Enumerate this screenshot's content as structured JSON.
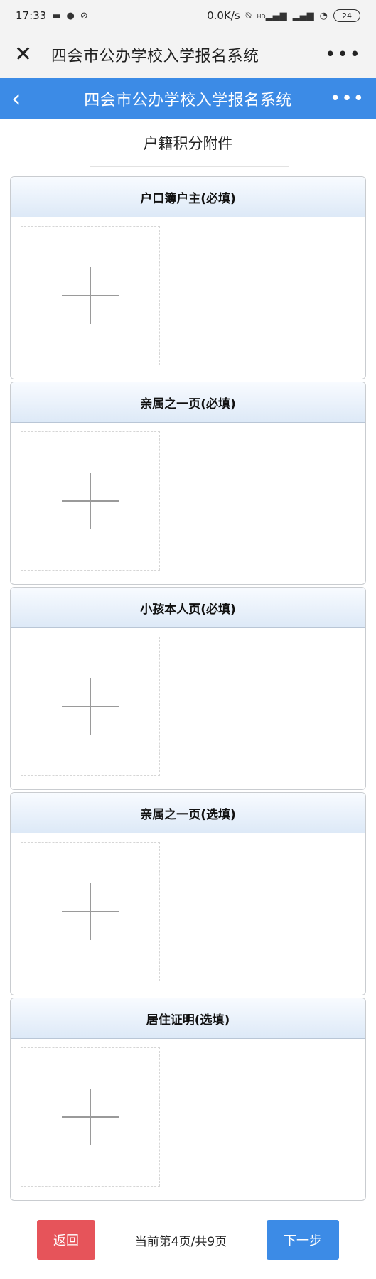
{
  "status_bar": {
    "time": "17:33",
    "net_speed": "0.0K/s",
    "network": "HD",
    "battery": "24"
  },
  "wechat_bar": {
    "title": "四会市公办学校入学报名系统",
    "close_icon": "close-icon",
    "more_icon": "more-icon"
  },
  "app_bar": {
    "title": "四会市公办学校入学报名系统",
    "accent": "#3c8be6"
  },
  "page": {
    "title": "户籍积分附件"
  },
  "sections": [
    {
      "label": "户口簿户主(必填)"
    },
    {
      "label": "亲属之一页(必填)"
    },
    {
      "label": "小孩本人页(必填)"
    },
    {
      "label": "亲属之一页(选填)"
    },
    {
      "label": "居住证明(选填)"
    }
  ],
  "footer": {
    "back_label": "返回",
    "page_indicator": "当前第4页/共9页",
    "next_label": "下一步",
    "back_color": "#e6545a",
    "next_color": "#3c8be6"
  }
}
